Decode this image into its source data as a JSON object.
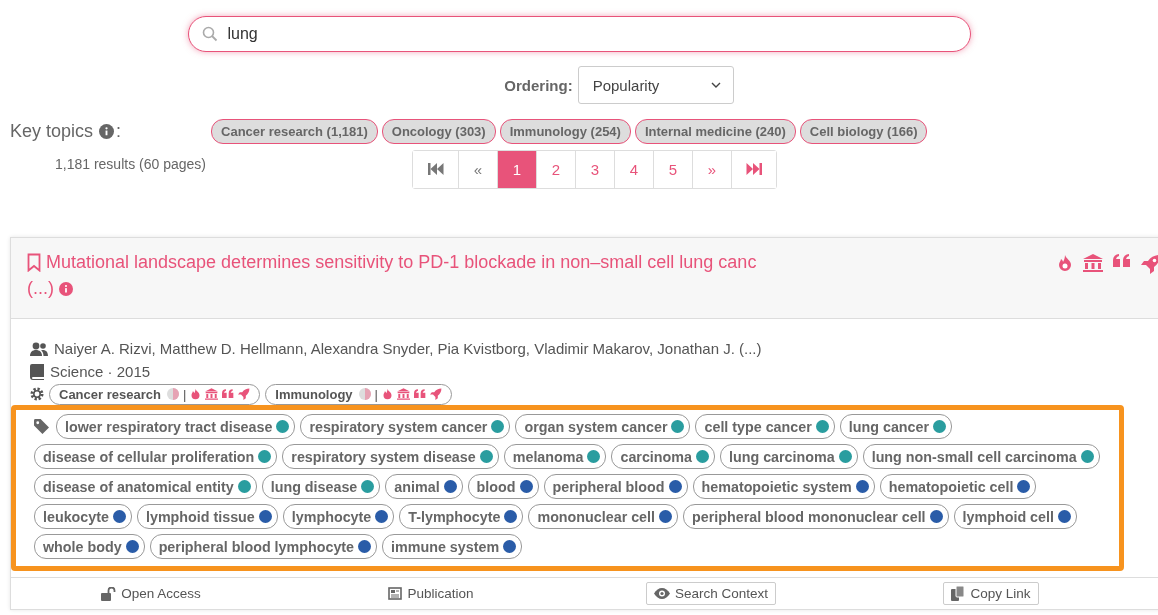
{
  "search": {
    "value": "lung"
  },
  "ordering": {
    "label": "Ordering:",
    "value": "Popularity"
  },
  "key_topics": {
    "label": "Key topics",
    "colon": ":",
    "chips": [
      "Cancer research (1,181)",
      "Oncology (303)",
      "Immunology (254)",
      "Internal medicine (240)",
      "Cell biology (166)"
    ]
  },
  "results_count": "1,181 results (60 pages)",
  "pagination": [
    {
      "kind": "first",
      "selected": false,
      "disabled": true
    },
    {
      "kind": "prev",
      "label": "«",
      "selected": false,
      "disabled": true
    },
    {
      "kind": "page",
      "label": "1",
      "selected": true,
      "disabled": false
    },
    {
      "kind": "page",
      "label": "2",
      "selected": false,
      "disabled": false
    },
    {
      "kind": "page",
      "label": "3",
      "selected": false,
      "disabled": false
    },
    {
      "kind": "page",
      "label": "4",
      "selected": false,
      "disabled": false
    },
    {
      "kind": "page",
      "label": "5",
      "selected": false,
      "disabled": false
    },
    {
      "kind": "next",
      "label": "»",
      "selected": false,
      "disabled": false
    },
    {
      "kind": "last",
      "selected": false,
      "disabled": false
    }
  ],
  "result": {
    "title": "Mutational landscape determines sensitivity to PD-1 blockade in non–small cell lung canc",
    "title_more": "(...)",
    "authors": "Naiyer A. Rizvi, Matthew D. Hellmann, Alexandra Snyder, Pia Kvistborg, Vladimir Makarov, Jonathan J. (...)",
    "venue": "Science · 2015",
    "fields": [
      "Cancer research",
      "Immunology"
    ],
    "field_separator": "|",
    "tags": [
      {
        "label": "lower respiratory tract disease",
        "color": "#2a9d9f"
      },
      {
        "label": "respiratory system cancer",
        "color": "#2a9d9f"
      },
      {
        "label": "organ system cancer",
        "color": "#2a9d9f"
      },
      {
        "label": "cell type cancer",
        "color": "#2a9d9f"
      },
      {
        "label": "lung cancer",
        "color": "#2a9d9f"
      },
      {
        "label": "disease of cellular proliferation",
        "color": "#2a9d9f"
      },
      {
        "label": "respiratory system disease",
        "color": "#2a9d9f"
      },
      {
        "label": "melanoma",
        "color": "#2a9d9f"
      },
      {
        "label": "carcinoma",
        "color": "#2a9d9f"
      },
      {
        "label": "lung carcinoma",
        "color": "#2a9d9f"
      },
      {
        "label": "lung non-small cell carcinoma",
        "color": "#2a9d9f"
      },
      {
        "label": "disease of anatomical entity",
        "color": "#2a9d9f"
      },
      {
        "label": "lung disease",
        "color": "#2a9d9f"
      },
      {
        "label": "animal",
        "color": "#2a5ca8"
      },
      {
        "label": "blood",
        "color": "#2a5ca8"
      },
      {
        "label": "peripheral blood",
        "color": "#2a5ca8"
      },
      {
        "label": "hematopoietic system",
        "color": "#2a5ca8"
      },
      {
        "label": "hematopoietic cell",
        "color": "#2a5ca8"
      },
      {
        "label": "leukocyte",
        "color": "#2a5ca8"
      },
      {
        "label": "lymphoid tissue",
        "color": "#2a5ca8"
      },
      {
        "label": "lymphocyte",
        "color": "#2a5ca8"
      },
      {
        "label": "T-lymphocyte",
        "color": "#2a5ca8"
      },
      {
        "label": "mononuclear cell",
        "color": "#2a5ca8"
      },
      {
        "label": "peripheral blood mononuclear cell",
        "color": "#2a5ca8"
      },
      {
        "label": "lymphoid cell",
        "color": "#2a5ca8"
      },
      {
        "label": "whole body",
        "color": "#2a5ca8"
      },
      {
        "label": "peripheral blood lymphocyte",
        "color": "#2a5ca8"
      },
      {
        "label": "immune system",
        "color": "#2a5ca8"
      }
    ],
    "actions": [
      {
        "kind": "link",
        "label": "Open Access"
      },
      {
        "kind": "link",
        "label": "Publication"
      },
      {
        "kind": "button",
        "label": "Search Context"
      },
      {
        "kind": "button",
        "label": "Copy Link"
      }
    ]
  }
}
